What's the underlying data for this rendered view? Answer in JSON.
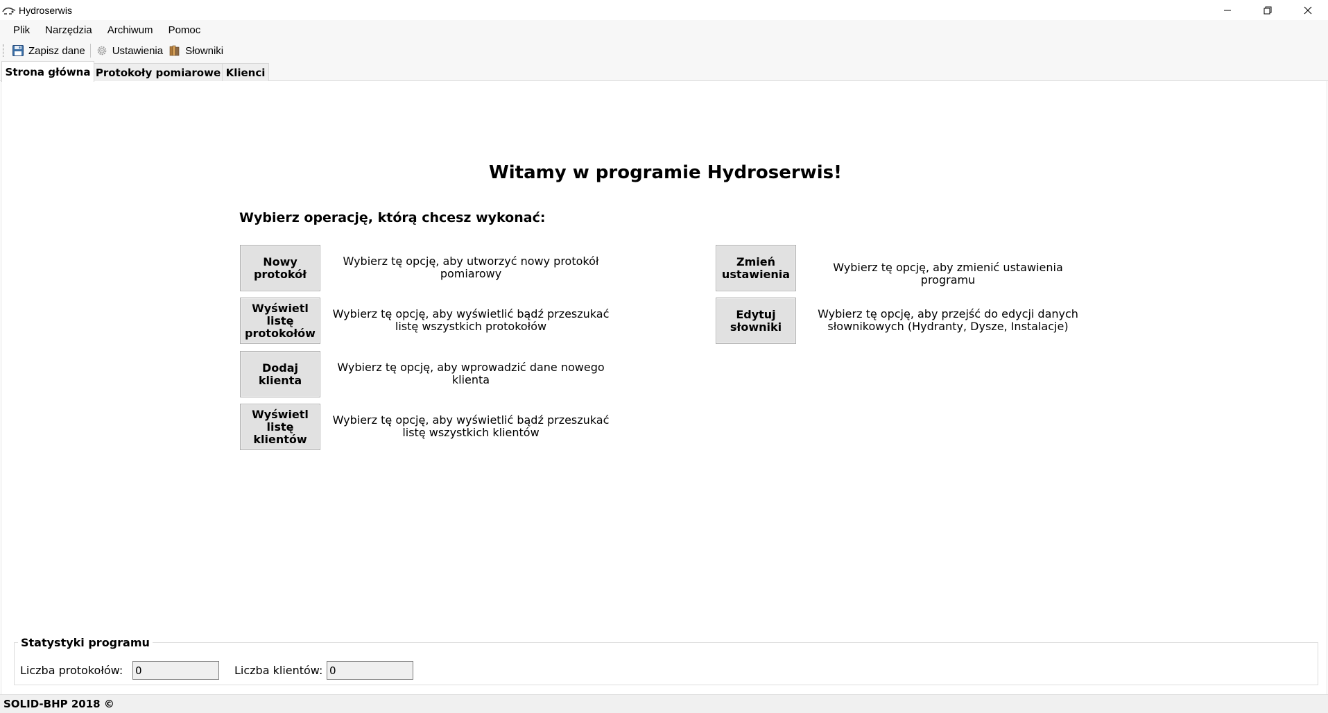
{
  "window": {
    "title": "Hydroserwis",
    "icon": "water-drop-icon"
  },
  "menu": {
    "items": [
      "Plik",
      "Narzędzia",
      "Archiwum",
      "Pomoc"
    ]
  },
  "toolbar": {
    "save_label": "Zapisz dane",
    "settings_label": "Ustawienia",
    "dictionaries_label": "Słowniki"
  },
  "tabs": [
    {
      "label": "Strona główna",
      "active": true
    },
    {
      "label": "Protokoły pomiarowe",
      "active": false
    },
    {
      "label": "Klienci",
      "active": false
    }
  ],
  "main": {
    "welcome": "Witamy w programie Hydroserwis!",
    "choose_prompt": "Wybierz operację, którą chcesz wykonać:",
    "operations": [
      {
        "button": "Nowy protokół",
        "description": "Wybierz tę opcję, aby utworzyć nowy protokół pomiarowy"
      },
      {
        "button": "Wyświetl listę protokołów",
        "description": "Wybierz tę opcję, aby wyświetlić bądź przeszukać listę wszystkich protokołów"
      },
      {
        "button": "Dodaj klienta",
        "description": "Wybierz tę opcję, aby wprowadzić dane nowego klienta"
      },
      {
        "button": "Wyświetl listę klientów",
        "description": "Wybierz tę opcję, aby wyświetlić bądź przeszukać listę wszystkich klientów"
      },
      {
        "button": "Zmień ustawienia",
        "description": "Wybierz tę opcję, aby zmienić ustawienia programu"
      },
      {
        "button": "Edytuj słowniki",
        "description": "Wybierz tę opcję, aby przejść do edycji danych słownikowych (Hydranty, Dysze, Instalacje)"
      }
    ]
  },
  "stats": {
    "title": "Statystyki programu",
    "protocols_label": "Liczba protokołów:",
    "protocols_value": "0",
    "clients_label": "Liczba klientów:",
    "clients_value": "0"
  },
  "status": {
    "text": "SOLID-BHP 2018 ©"
  }
}
